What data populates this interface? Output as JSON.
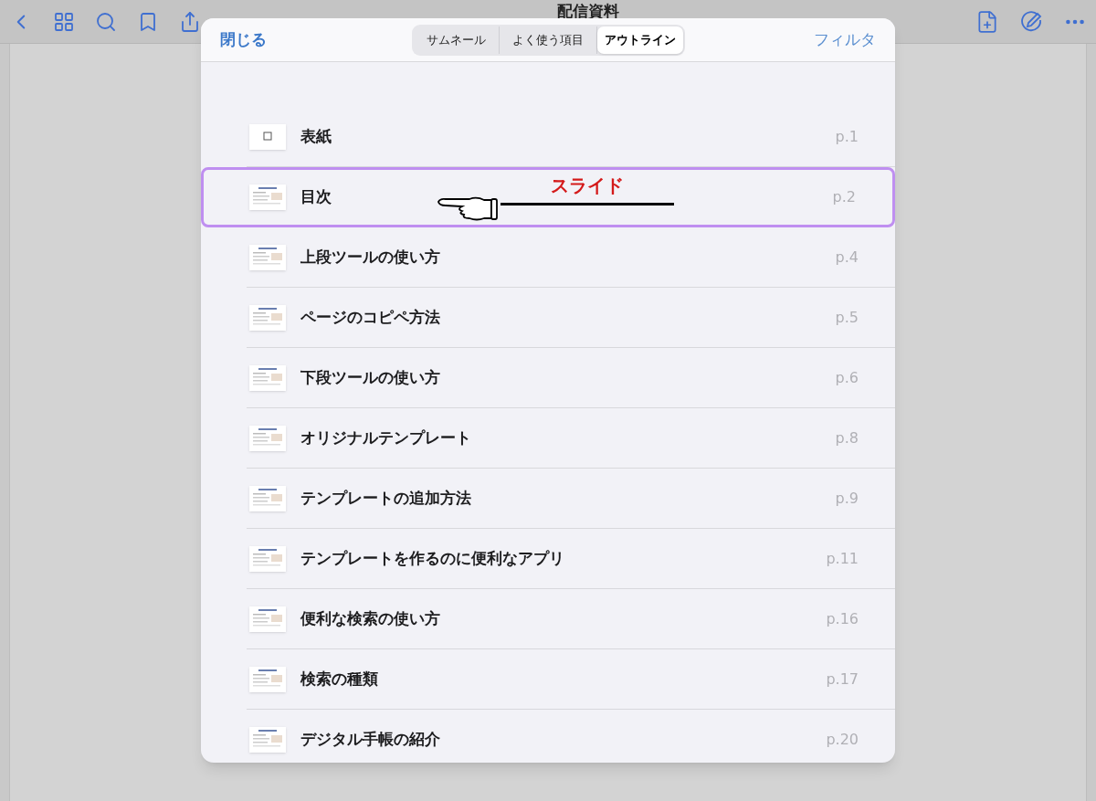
{
  "toolbar": {
    "title": "配信資料"
  },
  "modal": {
    "close": "閉じる",
    "filter": "フィルタ",
    "tabs": [
      {
        "label": "サムネール",
        "selected": false
      },
      {
        "label": "よく使う項目",
        "selected": false
      },
      {
        "label": "アウトライン",
        "selected": true
      }
    ],
    "rows": [
      {
        "title": "表紙",
        "page": "p.1",
        "highlighted": false
      },
      {
        "title": "目次",
        "page": "p.2",
        "highlighted": true
      },
      {
        "title": "上段ツールの使い方",
        "page": "p.4",
        "highlighted": false
      },
      {
        "title": "ページのコピペ方法",
        "page": "p.5",
        "highlighted": false
      },
      {
        "title": "下段ツールの使い方",
        "page": "p.6",
        "highlighted": false
      },
      {
        "title": "オリジナルテンプレート",
        "page": "p.8",
        "highlighted": false
      },
      {
        "title": "テンプレートの追加方法",
        "page": "p.9",
        "highlighted": false
      },
      {
        "title": "テンプレートを作るのに便利なアプリ",
        "page": "p.11",
        "highlighted": false
      },
      {
        "title": "便利な検索の使い方",
        "page": "p.16",
        "highlighted": false
      },
      {
        "title": "検索の種類",
        "page": "p.17",
        "highlighted": false
      },
      {
        "title": "デジタル手帳の紹介",
        "page": "p.20",
        "highlighted": false
      }
    ]
  },
  "annotation": {
    "label": "スライド"
  }
}
